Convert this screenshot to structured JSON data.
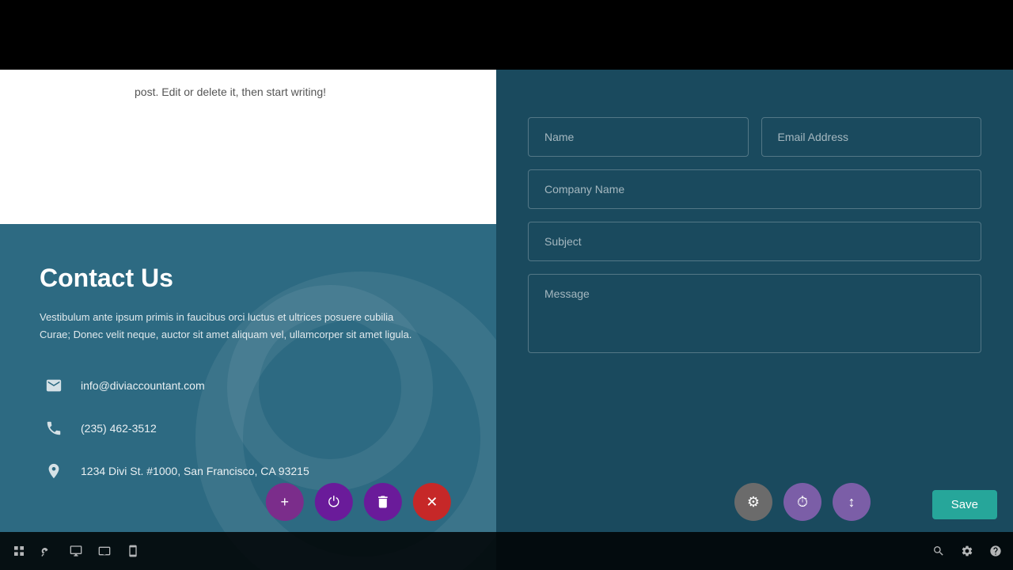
{
  "top": {
    "background": "#000000"
  },
  "white_section": {
    "text": "post. Edit or delete it, then start writing!"
  },
  "contact": {
    "title": "Contact Us",
    "description": "Vestibulum ante ipsum primis in faucibus orci luctus et ultrices posuere cubilia Curae; Donec velit neque, auctor sit amet aliquam vel, ullamcorper sit amet ligula.",
    "email": "info@diviaccountant.com",
    "phone": "(235) 462-3512",
    "address": "1234 Divi St. #1000, San Francisco, CA 93215"
  },
  "form": {
    "name_placeholder": "Name",
    "email_placeholder": "Email Address",
    "company_placeholder": "Company Name",
    "subject_placeholder": "Subject",
    "message_placeholder": "Message"
  },
  "toolbar": {
    "icons": [
      "grid-icon",
      "key-icon",
      "monitor-icon",
      "tablet-icon",
      "phone-icon"
    ],
    "right_icons": [
      "search-icon",
      "settings-icon",
      "help-icon"
    ],
    "save_label": "Save"
  },
  "floating_buttons": {
    "add_label": "+",
    "power_label": "⏻",
    "trash_label": "🗑",
    "close_label": "✕",
    "gear_label": "⚙",
    "clock_label": "⏱",
    "sort_label": "↕"
  }
}
